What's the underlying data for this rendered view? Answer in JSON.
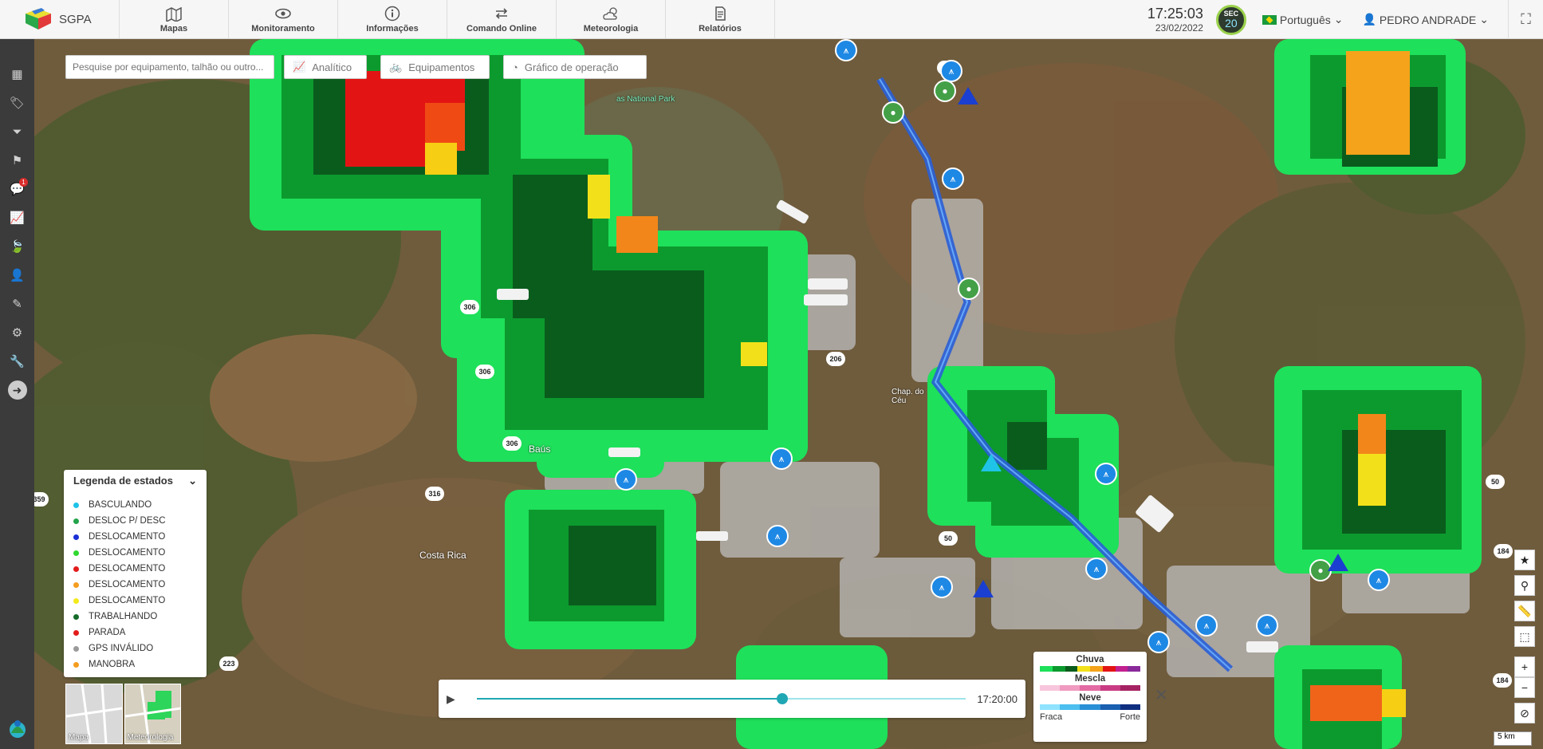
{
  "app": {
    "name": "SGPA"
  },
  "nav": [
    {
      "label": "Mapas",
      "icon": "map-icon"
    },
    {
      "label": "Monitoramento",
      "icon": "eye-icon"
    },
    {
      "label": "Informações",
      "icon": "info-icon"
    },
    {
      "label": "Comando Online",
      "icon": "arrows-icon"
    },
    {
      "label": "Meteorologia",
      "icon": "weather-icon"
    },
    {
      "label": "Relatórios",
      "icon": "report-icon"
    }
  ],
  "header": {
    "time": "17:25:03",
    "date": "23/02/2022",
    "sec_badge_top": "SEC",
    "sec_badge_value": "20",
    "language": "Português",
    "user": "PEDRO ANDRADE"
  },
  "sidebar": {
    "items": [
      {
        "icon": "dashboard-icon",
        "glyph": "▦"
      },
      {
        "icon": "tag-icon",
        "glyph": "🏷"
      },
      {
        "icon": "filter-icon",
        "glyph": "⏷"
      },
      {
        "icon": "flag-icon",
        "glyph": "⚑"
      },
      {
        "icon": "chat-icon",
        "glyph": "💬",
        "badge": "1"
      },
      {
        "icon": "chart-icon",
        "glyph": "📈"
      },
      {
        "icon": "leaf-icon",
        "glyph": "🍃"
      },
      {
        "icon": "user-icon",
        "glyph": "👤"
      },
      {
        "icon": "edit-icon",
        "glyph": "✎"
      },
      {
        "icon": "gears-icon",
        "glyph": "⚙"
      },
      {
        "icon": "wrench-icon",
        "glyph": "🔧"
      }
    ],
    "expand_glyph": "➜"
  },
  "toolbar": {
    "search_placeholder": "Pesquise por equipamento, talhão ou outro...",
    "analytic_label": "Analítico",
    "equipment_label": "Equipamentos",
    "operation_chart_label": "Gráfico de operação"
  },
  "legend": {
    "title": "Legenda de estados",
    "items": [
      {
        "label": "BASCULANDO",
        "color": "#1fc3e8"
      },
      {
        "label": "DESLOC P/ DESC",
        "color": "#23a34b"
      },
      {
        "label": "DESLOCAMENTO",
        "color": "#1a2fd6"
      },
      {
        "label": "DESLOCAMENTO",
        "color": "#2fd82f"
      },
      {
        "label": "DESLOCAMENTO",
        "color": "#e31b1b"
      },
      {
        "label": "DESLOCAMENTO",
        "color": "#f59d1f"
      },
      {
        "label": "DESLOCAMENTO",
        "color": "#f2ea1a"
      },
      {
        "label": "TRABALHANDO",
        "color": "#146b2a"
      },
      {
        "label": "PARADA",
        "color": "#e31b1b"
      },
      {
        "label": "GPS INVÁLIDO",
        "color": "#9a9a9a"
      },
      {
        "label": "MANOBRA",
        "color": "#f59d1f"
      }
    ]
  },
  "minimap": {
    "map_label": "Mapa",
    "weather_label": "Meteorologia"
  },
  "player": {
    "time": "17:20:00",
    "progress": 0.625
  },
  "weather_legend": {
    "rain": "Chuva",
    "mix": "Mescla",
    "snow": "Neve",
    "weak": "Fraca",
    "strong": "Forte"
  },
  "map": {
    "places": [
      "Costa Rica",
      "Baús",
      "Chap. do Céu",
      "as National Park"
    ],
    "roads": [
      "306",
      "306",
      "306",
      "316",
      "206",
      "50",
      "50",
      "184",
      "184",
      "223",
      "359",
      "50"
    ],
    "scale": "5 km"
  },
  "colors": {
    "accent": "#20a7b4",
    "topbar": "#f6f6f6",
    "sidebar": "#3b3b3b"
  }
}
